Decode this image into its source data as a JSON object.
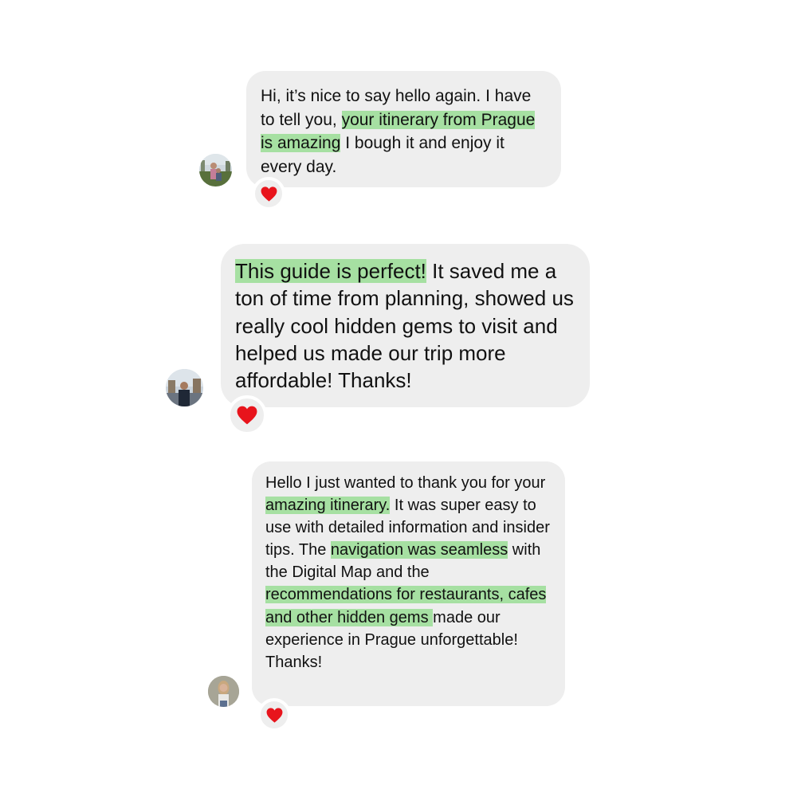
{
  "messages": [
    {
      "avatar_icon": "user-avatar-photo",
      "reaction_icon": "red-heart-icon",
      "segments": [
        {
          "text": "Hi, it’s nice to say hello again. I have to tell you, ",
          "highlight": false
        },
        {
          "text": "your itinerary from Prague is amazing",
          "highlight": true
        },
        {
          "text": " I bough it and enjoy it every day.",
          "highlight": false
        }
      ]
    },
    {
      "avatar_icon": "user-avatar-photo",
      "reaction_icon": "red-heart-icon",
      "segments": [
        {
          "text": "This guide is perfect!",
          "highlight": true
        },
        {
          "text": " It saved me a ton of time from planning, showed us really cool hidden gems to visit and helped us made our trip more affordable! Thanks!",
          "highlight": false
        }
      ]
    },
    {
      "avatar_icon": "user-avatar-photo",
      "reaction_icon": "red-heart-icon",
      "segments": [
        {
          "text": "Hello I just wanted to thank you for your ",
          "highlight": false
        },
        {
          "text": "amazing itinerary.",
          "highlight": true
        },
        {
          "text": " It was super easy to use with detailed information and insider tips. The ",
          "highlight": false
        },
        {
          "text": "navigation was seamless",
          "highlight": true
        },
        {
          "text": " with the Digital Map and the ",
          "highlight": false
        },
        {
          "text": "recommendations for restaurants, cafes and other hidden gems ",
          "highlight": true
        },
        {
          "text": " made our experience in Prague unforgettable! Thanks!",
          "highlight": false
        }
      ]
    }
  ],
  "colors": {
    "bubble": "#eeeeee",
    "highlight": "#a6e0a2",
    "text": "#111111",
    "heart": "#e8141c"
  }
}
